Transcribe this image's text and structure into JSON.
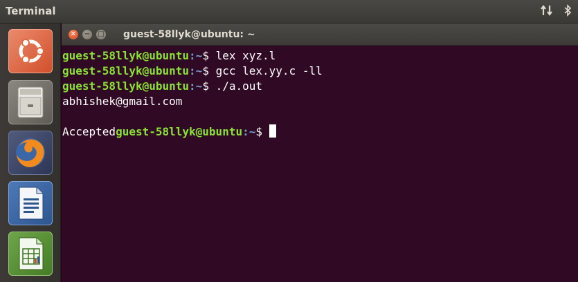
{
  "topbar": {
    "title": "Terminal",
    "icons": [
      "network-updown-icon",
      "bluetooth-icon"
    ]
  },
  "launcher": {
    "items": [
      {
        "name": "ubuntu-dash",
        "icon": "ubuntu-logo-icon",
        "color": "#dd4814"
      },
      {
        "name": "files",
        "icon": "file-cabinet-icon",
        "color": "#7a776f"
      },
      {
        "name": "firefox",
        "icon": "firefox-icon",
        "color": "#3b4468"
      },
      {
        "name": "writer",
        "icon": "libreoffice-writer-icon",
        "color": "#3a64a0"
      },
      {
        "name": "calc",
        "icon": "libreoffice-calc-icon",
        "color": "#56902f"
      }
    ]
  },
  "window": {
    "title": "guest-58llyk@ubuntu: ~",
    "buttons": {
      "close": "close-icon",
      "minimize": "minimize-icon",
      "maximize": "maximize-icon"
    }
  },
  "terminal": {
    "colors": {
      "background": "#300a24",
      "prompt_user": "#8ae234",
      "prompt_path": "#729fcf",
      "text": "#ffffff"
    },
    "lines": [
      {
        "user": "guest-58llyk@ubuntu",
        "path": "~",
        "symbol": "$",
        "command": " lex xyz.l"
      },
      {
        "user": "guest-58llyk@ubuntu",
        "path": "~",
        "symbol": "$",
        "command": " gcc lex.yy.c -ll"
      },
      {
        "user": "guest-58llyk@ubuntu",
        "path": "~",
        "symbol": "$",
        "command": " ./a.out"
      },
      {
        "output": "abhishek@gmail.com"
      },
      {
        "output": ""
      },
      {
        "prefix": "Accepted",
        "user": "guest-58llyk@ubuntu",
        "path": "~",
        "symbol": "$",
        "command": " "
      }
    ]
  }
}
